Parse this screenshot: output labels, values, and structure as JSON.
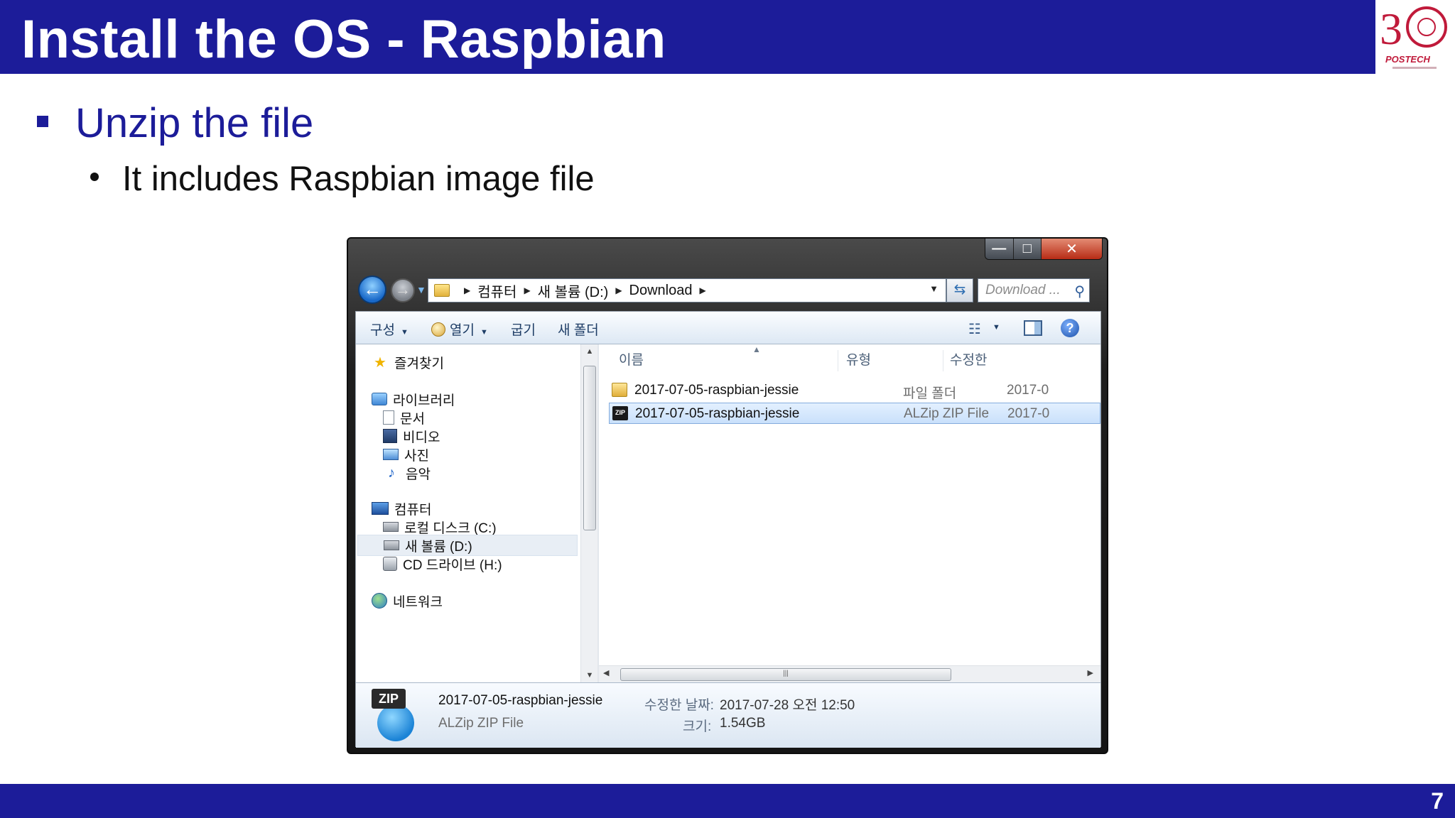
{
  "slide": {
    "title": "Install the OS - Raspbian",
    "bullet1": "Unzip the file",
    "bullet2": "It includes Raspbian image file",
    "page_number": "7",
    "colors": {
      "header": "#1c1c99",
      "bullet_text": "#1c1c99"
    }
  },
  "logo": {
    "label": "POSTECH"
  },
  "explorer": {
    "window_controls": {
      "minimize": "—",
      "maximize": "□",
      "close": "✕"
    },
    "address": {
      "crumbs": [
        "컴퓨터",
        "새 볼륨 (D:)",
        "Download"
      ]
    },
    "search": {
      "placeholder": "Download ..."
    },
    "toolbar": {
      "organize": "구성",
      "open": "열기",
      "burn": "굽기",
      "new_folder": "새 폴더"
    },
    "nav": {
      "favorites": "즐겨찾기",
      "libraries": "라이브러리",
      "documents": "문서",
      "videos": "비디오",
      "pictures": "사진",
      "music": "음악",
      "computer": "컴퓨터",
      "local_disk": "로컬 디스크 (C:)",
      "new_volume": "새 볼륨 (D:)",
      "cd_drive": "CD 드라이브 (H:)",
      "network": "네트워크"
    },
    "columns": {
      "name": "이름",
      "type": "유형",
      "modified": "수정한"
    },
    "files": [
      {
        "name": "2017-07-05-raspbian-jessie",
        "type": "파일 폴더",
        "date": "2017-0",
        "icon": "folder-icon"
      },
      {
        "name": "2017-07-05-raspbian-jessie",
        "type": "ALZip ZIP File",
        "date": "2017-0",
        "icon": "zip-file-icon"
      }
    ],
    "details": {
      "icon_tag": "ZIP",
      "name": "2017-07-05-raspbian-jessie",
      "type": "ALZip ZIP File",
      "modified_label": "수정한 날짜:",
      "modified_value": "2017-07-28 오전 12:50",
      "size_label": "크기:",
      "size_value": "1.54GB"
    }
  }
}
